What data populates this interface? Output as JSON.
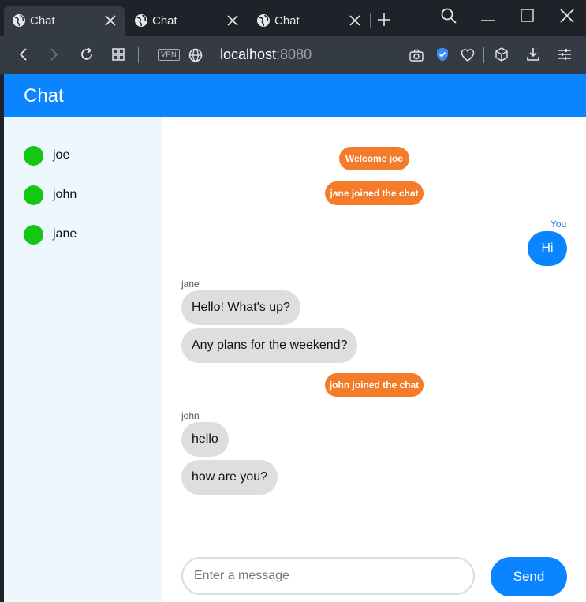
{
  "browser": {
    "tabs": [
      {
        "title": "Chat"
      },
      {
        "title": "Chat"
      },
      {
        "title": "Chat"
      }
    ],
    "vpn_label": "VPN",
    "url_host": "localhost",
    "url_port": ":8080"
  },
  "app": {
    "title": "Chat",
    "users": [
      {
        "name": "joe",
        "status_color": "#13c713"
      },
      {
        "name": "john",
        "status_color": "#13c713"
      },
      {
        "name": "jane",
        "status_color": "#13c713"
      }
    ],
    "messages": {
      "system_welcome": "Welcome joe",
      "system_jane_joined": "jane joined the chat",
      "you_label": "You",
      "you_text": "Hi",
      "jane_label": "jane",
      "jane_text_1": "Hello! What's up?",
      "jane_text_2": "Any plans for the weekend?",
      "system_john_joined": "john joined the chat",
      "john_label": "john",
      "john_text_1": "hello",
      "john_text_2": "how are you?"
    },
    "composer": {
      "placeholder": "Enter a message",
      "value": "",
      "send_label": "Send"
    }
  },
  "colors": {
    "accent": "#0b84ff",
    "system_message": "#f47b2a",
    "online": "#13c713",
    "sidebar_bg": "#eef7fd"
  }
}
